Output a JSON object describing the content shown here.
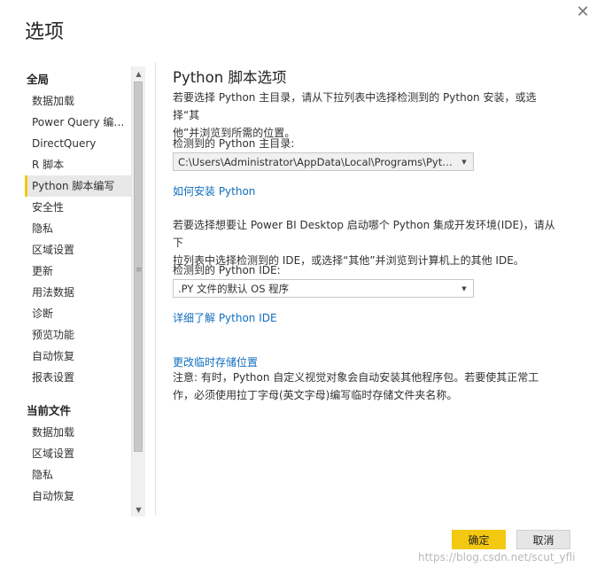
{
  "dialog": {
    "title": "选项",
    "close_glyph": "✕"
  },
  "sidebar": {
    "global_header": "全局",
    "global_items": [
      {
        "label": "数据加载"
      },
      {
        "label": "Power Query 编辑..."
      },
      {
        "label": "DirectQuery"
      },
      {
        "label": "R 脚本"
      },
      {
        "label": "Python 脚本编写"
      },
      {
        "label": "安全性"
      },
      {
        "label": "隐私"
      },
      {
        "label": "区域设置"
      },
      {
        "label": "更新"
      },
      {
        "label": "用法数据"
      },
      {
        "label": "诊断"
      },
      {
        "label": "预览功能"
      },
      {
        "label": "自动恢复"
      },
      {
        "label": "报表设置"
      }
    ],
    "current_header": "当前文件",
    "current_items": [
      {
        "label": "数据加载"
      },
      {
        "label": "区域设置"
      },
      {
        "label": "隐私"
      },
      {
        "label": "自动恢复"
      }
    ],
    "selected": "Python 脚本编写"
  },
  "main": {
    "title": "Python 脚本选项",
    "intro_line1": "若要选择 Python 主目录，请从下拉列表中选择检测到的 Python 安装，或选择“其",
    "intro_line2": "他”并浏览到所需的位置。",
    "home_label": "检测到的 Python 主目录:",
    "home_value": "C:\\Users\\Administrator\\AppData\\Local\\Programs\\Python...",
    "install_link": "如何安装 Python",
    "ide_para_line1": "若要选择想要让 Power BI Desktop 启动哪个 Python 集成开发环境(IDE)，请从下",
    "ide_para_line2": "拉列表中选择检测到的 IDE，或选择“其他”并浏览到计算机上的其他 IDE。",
    "ide_label": "检测到的 Python IDE:",
    "ide_value": ".PY 文件的默认 OS 程序",
    "ide_link": "详细了解 Python IDE",
    "temp_link": "更改临时存储位置",
    "note_line1": "注意: 有时，Python 自定义视觉对象会自动安装其他程序包。若要使其正常工",
    "note_line2": "作，必须使用拉丁字母(英文字母)编写临时存储文件夹名称。"
  },
  "buttons": {
    "ok": "确定",
    "cancel": "取消"
  },
  "watermark": "https://blog.csdn.net/scut_yfli",
  "colors": {
    "accent": "#f2c811",
    "link": "#106ebe"
  }
}
